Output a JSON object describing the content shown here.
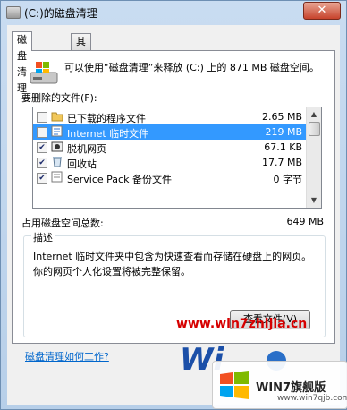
{
  "window": {
    "title": "(C:)的磁盘清理",
    "close_glyph": "✕"
  },
  "tabs": [
    {
      "label": "磁盘清理"
    },
    {
      "label": "其他选项"
    }
  ],
  "intro": {
    "text": "可以使用“磁盘清理”来释放 (C:) 上的 871 MB 磁盘空间。"
  },
  "files_label": "要删除的文件(F):",
  "files": [
    {
      "checked": false,
      "icon": "folder-icon",
      "name": "已下载的程序文件",
      "size": "2.65 MB",
      "selected": false
    },
    {
      "checked": false,
      "icon": "internet-files-icon",
      "name": "Internet 临时文件",
      "size": "219 MB",
      "selected": true
    },
    {
      "checked": true,
      "icon": "offline-page-icon",
      "name": "脱机网页",
      "size": "67.1 KB",
      "selected": false
    },
    {
      "checked": true,
      "icon": "recycle-bin-icon",
      "name": "回收站",
      "size": "17.7 MB",
      "selected": false
    },
    {
      "checked": true,
      "icon": "service-pack-icon",
      "name": "Service Pack 备份文件",
      "size": "0 字节",
      "selected": false
    }
  ],
  "total": {
    "label": "占用磁盘空间总数:",
    "value": "649 MB"
  },
  "description": {
    "title": "描述",
    "text": "Internet 临时文件夹中包含为快速查看而存储在硬盘上的网页。你的网页个人化设置将被完整保留。",
    "button_label": "查看文件(V)"
  },
  "help_link": "磁盘清理如何工作?",
  "watermark": {
    "url": "www.win7zhijia.cn",
    "brand": "WIN7旗舰版",
    "site": "www.win7qjb.com"
  },
  "colors": {
    "selection": "#3399ff",
    "link": "#0066cc",
    "watermark": "#d60000"
  }
}
